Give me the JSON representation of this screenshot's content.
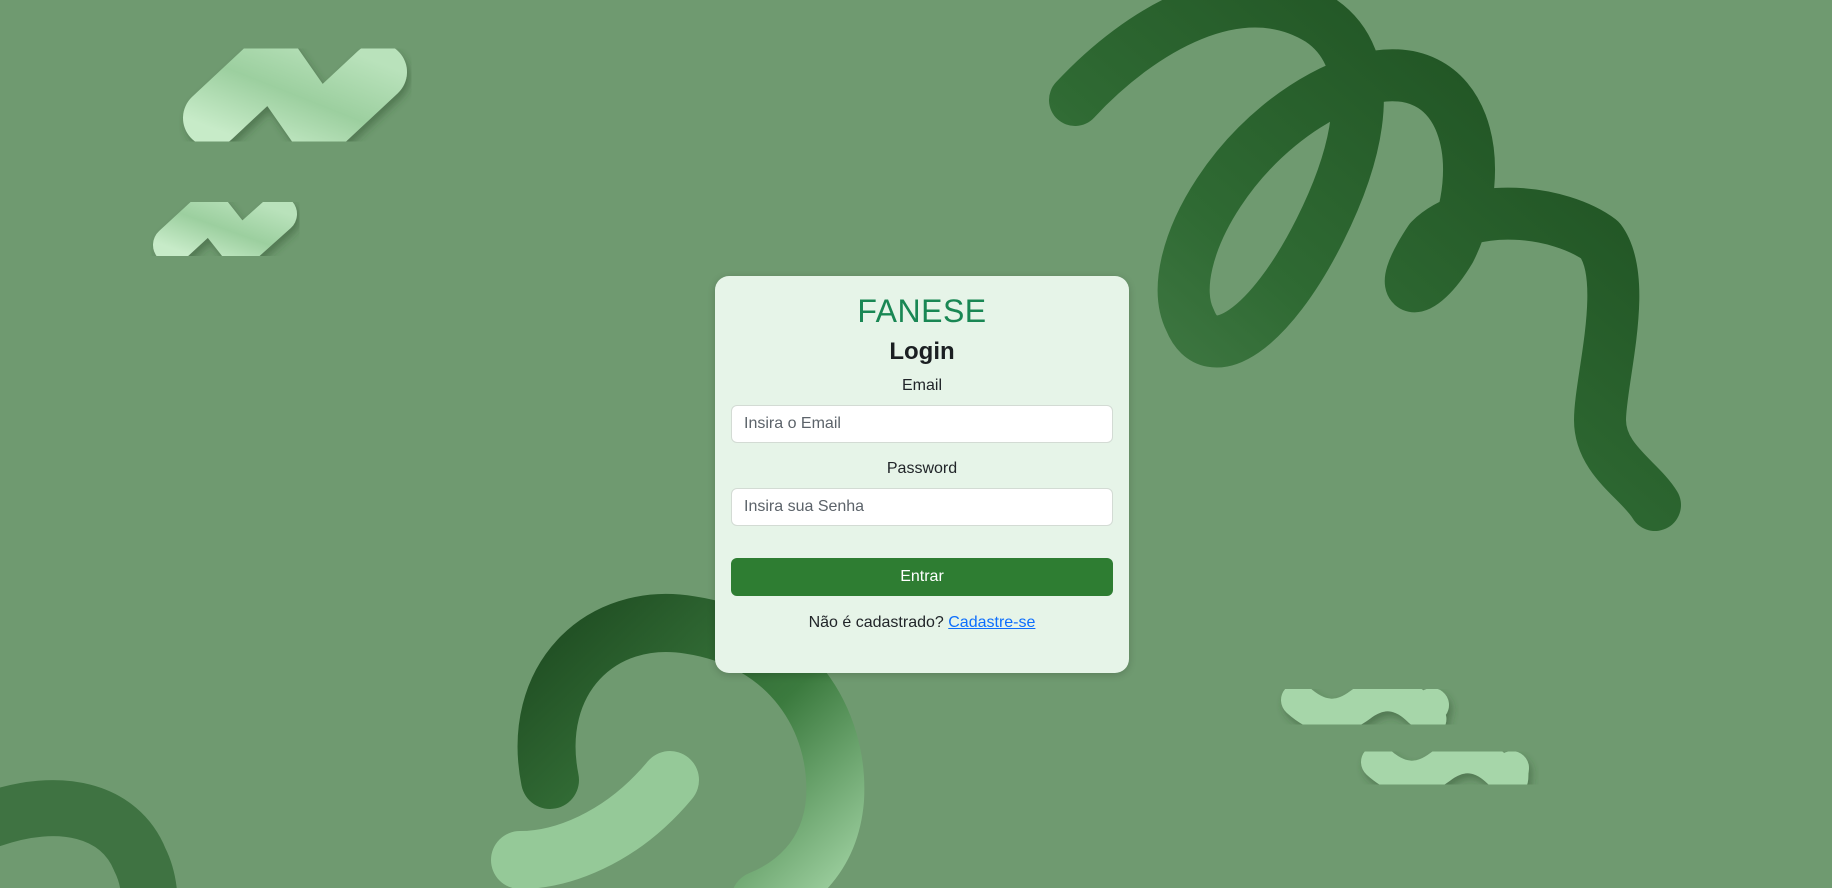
{
  "colors": {
    "background": "#6f9a70",
    "card": "#e6f4e8",
    "brand": "#198754",
    "button": "#2e7d32",
    "link": "#0d6efd",
    "dark_tube": "#1f4d22",
    "light_tube": "#a8d5ac"
  },
  "login": {
    "brand": "FANESE",
    "title": "Login",
    "email_label": "Email",
    "email_placeholder": "Insira o Email",
    "password_label": "Password",
    "password_placeholder": "Insira sua Senha",
    "submit_label": "Entrar",
    "register_prompt": "Não é cadastrado?",
    "register_link": "Cadastre-se"
  }
}
